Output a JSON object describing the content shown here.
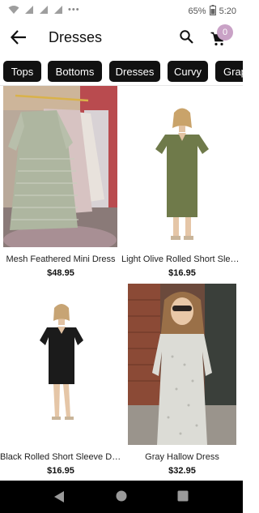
{
  "status_bar": {
    "dots": "•••",
    "battery": "65%",
    "time": "5:20"
  },
  "app_bar": {
    "title": "Dresses",
    "cart_count": "0",
    "back_icon": "arrow-back-icon",
    "search_icon": "search-icon",
    "cart_icon": "shopping-cart-icon"
  },
  "categories": [
    {
      "label": "Tops"
    },
    {
      "label": "Bottoms"
    },
    {
      "label": "Dresses"
    },
    {
      "label": "Curvy"
    },
    {
      "label": "Grap"
    }
  ],
  "products": [
    {
      "name": "Mesh Feathered Mini Dress",
      "price": "$48.95"
    },
    {
      "name": "Light Olive Rolled Short Sleeve Dress",
      "price": "$16.95"
    },
    {
      "name": "Black Rolled Short Sleeve Dress",
      "price": "$16.95"
    },
    {
      "name": "Gray Hallow Dress",
      "price": "$32.95"
    }
  ],
  "colors": {
    "chip_bg": "#111111",
    "badge": "#c9a2c6",
    "nav_bar": "#000000"
  }
}
